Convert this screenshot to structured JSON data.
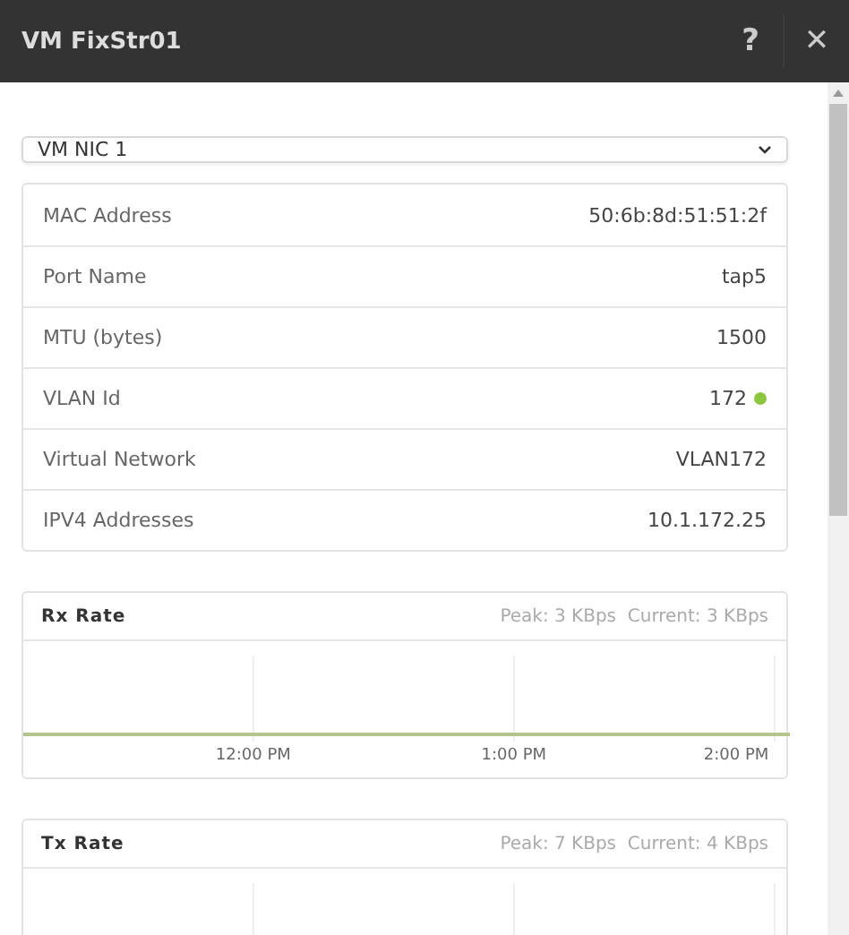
{
  "window": {
    "title": "VM FixStr01",
    "help": "?",
    "close": "✕"
  },
  "nic_select": {
    "value": "VM NIC 1"
  },
  "properties": [
    {
      "label": "MAC Address",
      "value": "50:6b:8d:51:51:2f"
    },
    {
      "label": "Port Name",
      "value": "tap5"
    },
    {
      "label": "MTU (bytes)",
      "value": "1500"
    },
    {
      "label": "VLAN Id",
      "value": "172",
      "color": "#8dc63f"
    },
    {
      "label": "Virtual Network",
      "value": "VLAN172"
    },
    {
      "label": "IPV4 Addresses",
      "value": "10.1.172.25"
    }
  ],
  "rate_cards": [
    {
      "title": "Rx Rate",
      "peak": "Peak: 3 KBps",
      "current": "Current: 3 KBps",
      "time_labels": [
        "12:00 PM",
        "1:00 PM",
        "2:00 PM"
      ]
    },
    {
      "title": "Tx Rate",
      "peak": "Peak: 7 KBps",
      "current": "Current: 4 KBps"
    }
  ]
}
